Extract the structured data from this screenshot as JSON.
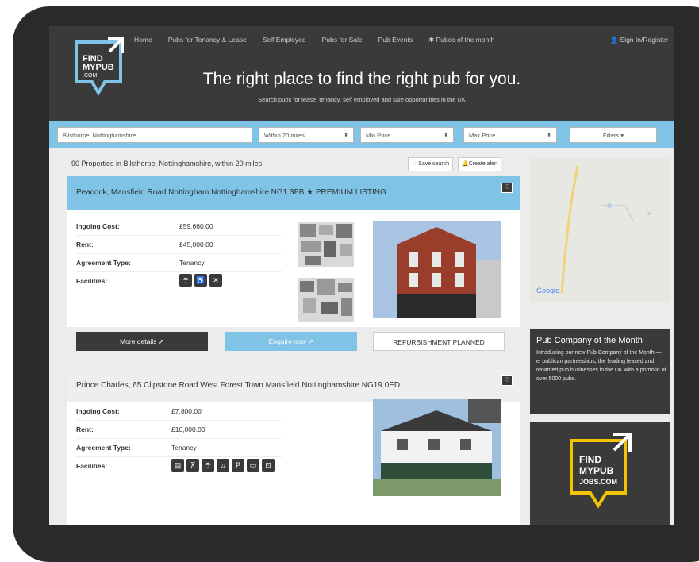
{
  "logo": {
    "line1": "FIND",
    "line2": "MYPUB",
    "line3": ".COM"
  },
  "nav": {
    "items": [
      "Home",
      "Pubs for Tenancy & Lease",
      "Self Employed",
      "Pubs for Sale",
      "Pub Events",
      "Pubco of the month"
    ],
    "signin": "Sign In/Register"
  },
  "hero": {
    "title": "The right place to find the right pub for you.",
    "subtitle": "Search pubs for lease, tenancy, self employed and sale opportunities in the UK"
  },
  "search": {
    "location": "Bilsthorpe, Nottinghamshire",
    "radius": "Within 20 miles",
    "min_price": "Min Price",
    "max_price": "Max Price",
    "filters": "Filters"
  },
  "results": {
    "count_text": "90 Properties in Bilsthorpe, Nottinghamshire, within 20 miles",
    "save_search": "Save search",
    "create_alert": "Create alert"
  },
  "listings": [
    {
      "title": "Peacock, Mansfield Road Nottingham Nottinghamshire NG1 3FB ★ PREMIUM LISTING",
      "ingoing_label": "Ingoing Cost:",
      "ingoing": "£59,660.00",
      "rent_label": "Rent:",
      "rent": "£45,000.00",
      "agreement_label": "Agreement Type:",
      "agreement": "Tenancy",
      "facilities_label": "Facilities:",
      "more_details": "More details",
      "enquire": "Enquire now",
      "status": "REFURBISHMENT PLANNED"
    },
    {
      "title": "Prince Charles, 65 Clipstone Road West Forest Town Mansfield Nottinghamshire NG19 0ED",
      "ingoing_label": "Ingoing Cost:",
      "ingoing": "£7,800.00",
      "rent_label": "Rent:",
      "rent": "£10,000.00",
      "agreement_label": "Agreement Type:",
      "agreement": "Tenancy",
      "facilities_label": "Facilities:"
    }
  ],
  "sidebar": {
    "pcm_title": "Pub Company of the Month",
    "pcm_text": "Introducing our new Pub Company of the Month — ei publican partnerships, the leading leased and tenanted pub businesses in the UK with a portfolio of over 5000 pubs.",
    "jobs_logo": {
      "line1": "FIND",
      "line2": "MYPUB",
      "line3": "JOBS.COM"
    },
    "map_label": "Google"
  },
  "colors": {
    "accent": "#7fc3e6",
    "dark": "#3a3a3a",
    "yellow": "#f2c300"
  }
}
